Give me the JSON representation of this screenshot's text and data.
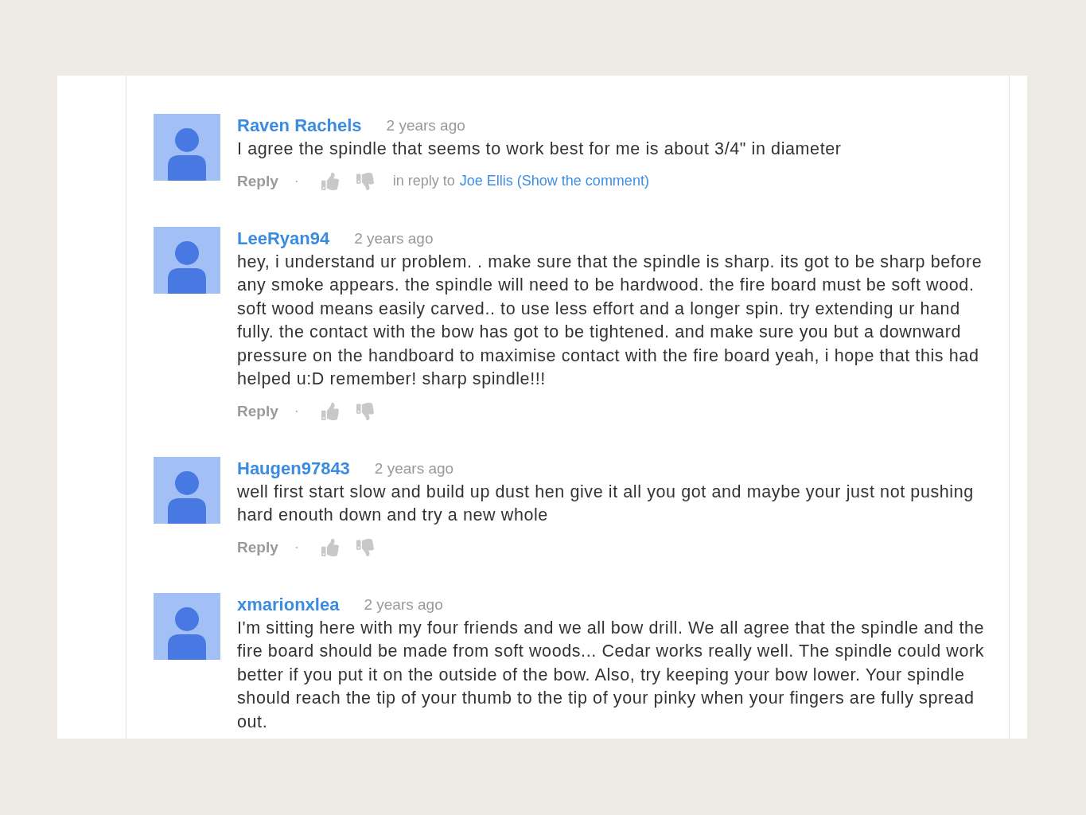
{
  "comments": [
    {
      "author": "Raven Rachels",
      "time": "2 years ago",
      "text": "I agree the spindle that seems to work best for me is about 3/4\" in diameter",
      "reply": "Reply",
      "separator": "·",
      "in_reply_to": {
        "prefix": "in reply to",
        "link": "Joe Ellis (Show the comment)"
      }
    },
    {
      "author": "LeeRyan94",
      "time": "2 years ago",
      "text": "hey, i understand ur problem. . make sure that the spindle is sharp. its got to be sharp before any smoke appears. the spindle will need to be hardwood. the fire board must be soft wood. soft wood means easily carved.. to use less effort and a longer spin. try extending ur hand fully. the contact with the bow has got to be tightened. and make sure you but a downward pressure on the handboard to maximise contact with the fire board yeah, i hope that this had helped u:D remember! sharp spindle!!!",
      "reply": "Reply",
      "separator": "·"
    },
    {
      "author": "Haugen97843",
      "time": "2 years ago",
      "text": "well first start slow and build up dust hen give it all you got and maybe your just not pushing hard enouth down and try a new whole",
      "reply": "Reply",
      "separator": "·"
    },
    {
      "author": "xmarionxlea",
      "time": "2 years ago",
      "text": "I'm sitting here with my four friends and we all bow drill. We all agree that the spindle and the fire board should be made from soft woods... Cedar works really well. The spindle could work better if you put it on the outside of the bow. Also, try keeping your bow lower. Your spindle should reach the tip of your thumb to the tip of your pinky when your fingers are fully spread out."
    }
  ]
}
